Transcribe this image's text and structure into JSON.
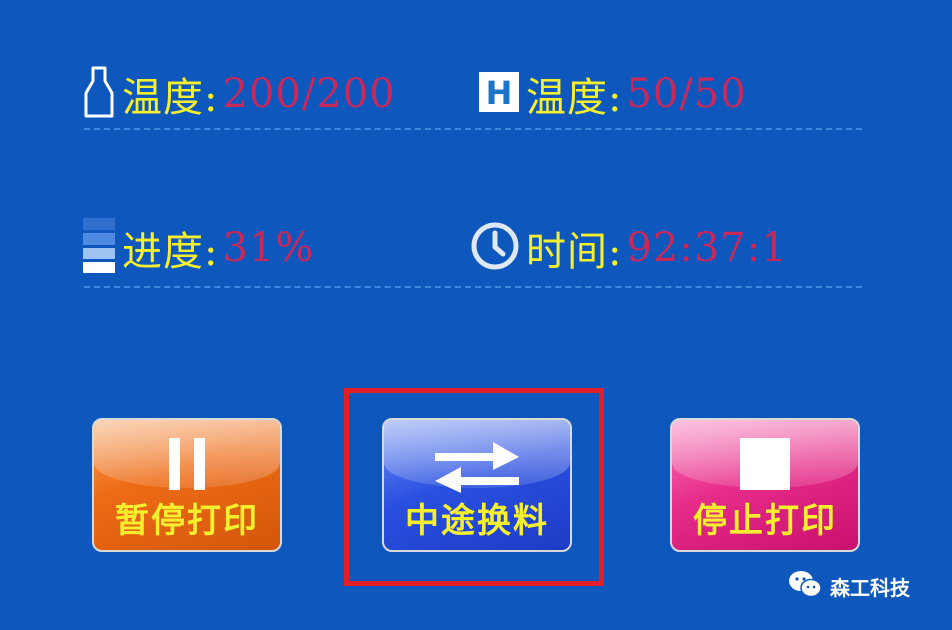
{
  "status": {
    "nozzle_temp": {
      "label": "温度:",
      "value": "200/200",
      "icon": "nozzle-icon"
    },
    "bed_temp": {
      "label": "温度:",
      "value": "50/50",
      "icon": "hotbed-h-icon",
      "badge": "H"
    },
    "progress": {
      "label": "进度:",
      "value": "31%",
      "icon": "progress-bars-icon"
    },
    "time": {
      "label": "时间:",
      "value": "92:37:1",
      "icon": "clock-icon"
    }
  },
  "buttons": {
    "pause": {
      "label": "暂停打印",
      "icon": "pause-icon",
      "color": "#ee6b16"
    },
    "change_filament": {
      "label": "中途换料",
      "icon": "swap-arrows-icon",
      "color": "#2a50e0"
    },
    "stop": {
      "label": "停止打印",
      "icon": "stop-square-icon",
      "color": "#e72c8a"
    }
  },
  "colors": {
    "background": "#0d57bd",
    "label_text": "#f5ef2e",
    "value_text": "#c8285a",
    "highlight_box": "#e21e28"
  },
  "watermark": {
    "text": "森工科技",
    "icon": "wechat-icon"
  }
}
